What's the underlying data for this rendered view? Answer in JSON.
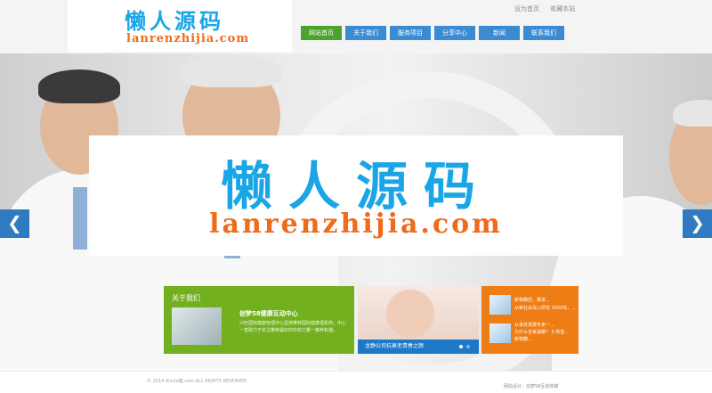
{
  "header": {
    "logo_cn": "懒人源码",
    "logo_en": "lanrenzhijia.com",
    "top_links": [
      "设为首页",
      "收藏本站"
    ]
  },
  "nav": {
    "items": [
      "网站首页",
      "关于我们",
      "服务项目",
      "分享中心",
      "新闻",
      "联系我们"
    ],
    "active_index": 0
  },
  "banner": {
    "watermark_cn": "懒人源码",
    "watermark_en": "lanrenzhijia.com",
    "prev_icon": "chevron-left-icon",
    "next_icon": "chevron-right-icon",
    "prev_glyph": "❮",
    "next_glyph": "❯"
  },
  "cards": {
    "about": {
      "title": "关于我们",
      "headline": "创梦58健康互动中心",
      "desc": "兴旺国际健康管理中心坚持推荐国际健康理机构，中心一直致力于关注推荐最好的中药力量一籍养和谐。"
    },
    "photo": {
      "caption": "龙静公司抗衰老青春之颜"
    },
    "news": {
      "items": [
        "新物霸控，推进...",
        "从新社会深入研究 1950年，...",
        "从承苏发展专家一...",
        "为什么全家温暖？ 0 新室...",
        "新物霸..."
      ]
    }
  },
  "footer": {
    "copyright": "© 2014 divcle健.com ALL RIGHTS RESERVED",
    "credit": "网站设计：创梦58互动传媒"
  },
  "colors": {
    "brand_blue": "#1aa6e6",
    "brand_orange": "#ef6a1a",
    "nav_blue": "#3b8bd3",
    "nav_active": "#4aa32e",
    "card_green": "#72b01f",
    "card_orange": "#ef7d15"
  }
}
